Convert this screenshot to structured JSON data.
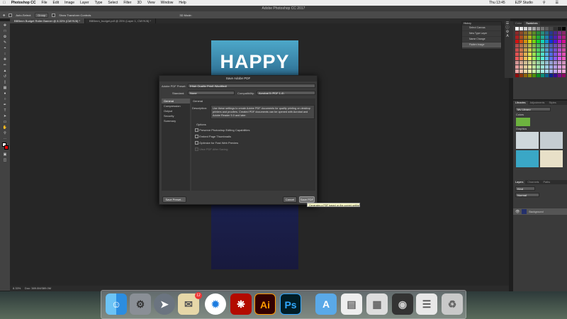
{
  "menubar": {
    "apple": "",
    "app": "Photoshop CC",
    "items": [
      "File",
      "Edit",
      "Image",
      "Layer",
      "Type",
      "Select",
      "Filter",
      "3D",
      "View",
      "Window",
      "Help"
    ],
    "clock": "Thu 13:45",
    "user": "EZP Studio"
  },
  "window_title": "Adobe Photoshop CC 2017",
  "options": {
    "auto_select": "Auto-Select:",
    "group": "Group",
    "show_transform": "Show Transform Controls",
    "mode_3d": "3D Mode:"
  },
  "doc_tabs": [
    "BBBmm Budget Roller Banner @ 8.33% (CMYK/8) *",
    "BBBmm_budget.pdf @ 25% (Layer 1, CMYK/8) *"
  ],
  "artboard": {
    "headline": "HAPPY"
  },
  "status": {
    "zoom": "8.33%",
    "doc": "Doc: 389.0M/389.0M"
  },
  "dialog": {
    "title": "Save Adobe PDF",
    "preset_label": "Adobe PDF Preset:",
    "preset_value": "[High Quality Print] (Modified)",
    "standard_label": "Standard:",
    "standard_value": "None",
    "compat_label": "Compatibility:",
    "compat_value": "Acrobat 5 (PDF 1.4)",
    "sidebar": [
      "General",
      "Compression",
      "Output",
      "Security",
      "Summary"
    ],
    "section_title": "General",
    "description_label": "Description:",
    "description": "Use these settings to create Adobe PDF documents for quality printing on desktop printers and proofers.  Created PDF documents can be opened with Acrobat and Adobe Reader 5.0 and later.",
    "options_title": "Options",
    "options": [
      "Preserve Photoshop Editing Capabilities",
      "Embed Page Thumbnails",
      "Optimize for Fast Web Preview",
      "View PDF After Saving"
    ],
    "save_preset": "Save Preset...",
    "cancel": "Cancel",
    "save_pdf": "Save PDF",
    "tooltip": "Generates a PDF based on the current setting"
  },
  "history": {
    "title": "History",
    "items": [
      "Select Canvas",
      "New Type Layer",
      "Name Change",
      "Flatten Image"
    ]
  },
  "panels": {
    "color_tabs": [
      "Color",
      "Swatches"
    ],
    "lib_tabs": [
      "Libraries",
      "Adjustments",
      "Styles"
    ],
    "lib_name": "My Library",
    "lib_colors": "Colors",
    "lib_graphics": "Graphics",
    "layer_tabs": [
      "Layers",
      "Channels",
      "Paths"
    ],
    "layer_kind": "Kind",
    "layer_mode": "Normal",
    "layer_name": "Background"
  },
  "dock": {
    "apps": [
      "Finder",
      "Settings",
      "Launchpad",
      "Mail",
      "Safari",
      "Acrobat",
      "Illustrator",
      "Photoshop",
      "Apps",
      "Docs",
      "Preview",
      "Photos",
      "Files",
      "Trash"
    ],
    "ai": "Ai",
    "ps": "Ps",
    "mail_badge": "12"
  },
  "colors": {
    "ps_blue": "#31a8ff",
    "ai_orange": "#ff9a00",
    "acrobat_red": "#b30b00"
  }
}
